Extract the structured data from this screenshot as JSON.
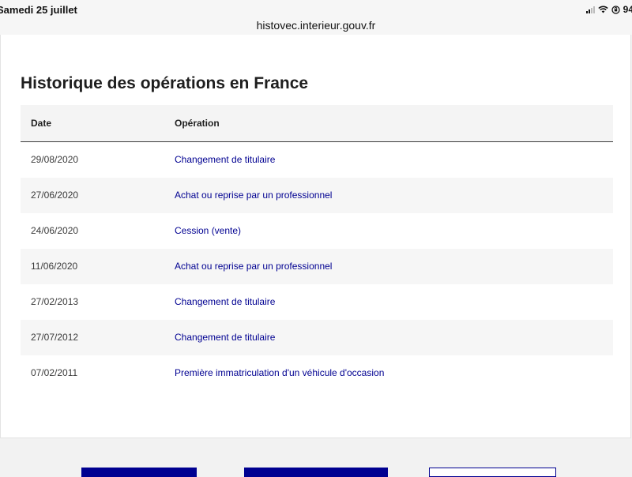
{
  "status_bar": {
    "time_date": "Samedi 25 juillet",
    "battery_text": "94"
  },
  "browser": {
    "url": "histovec.interieur.gouv.fr"
  },
  "page": {
    "title": "Historique des opérations en France",
    "table": {
      "headers": [
        "Date",
        "Opération"
      ],
      "rows": [
        {
          "date": "29/08/2020",
          "operation": "Changement de titulaire"
        },
        {
          "date": "27/06/2020",
          "operation": "Achat ou reprise par un professionnel"
        },
        {
          "date": "24/06/2020",
          "operation": "Cession (vente)"
        },
        {
          "date": "11/06/2020",
          "operation": "Achat ou reprise par un professionnel"
        },
        {
          "date": "27/02/2013",
          "operation": "Changement de titulaire"
        },
        {
          "date": "27/07/2012",
          "operation": "Changement de titulaire"
        },
        {
          "date": "07/02/2011",
          "operation": "Première immatriculation d'un véhicule d'occasion"
        }
      ]
    }
  },
  "colors": {
    "link": "#000091",
    "primary_button": "#000091"
  }
}
